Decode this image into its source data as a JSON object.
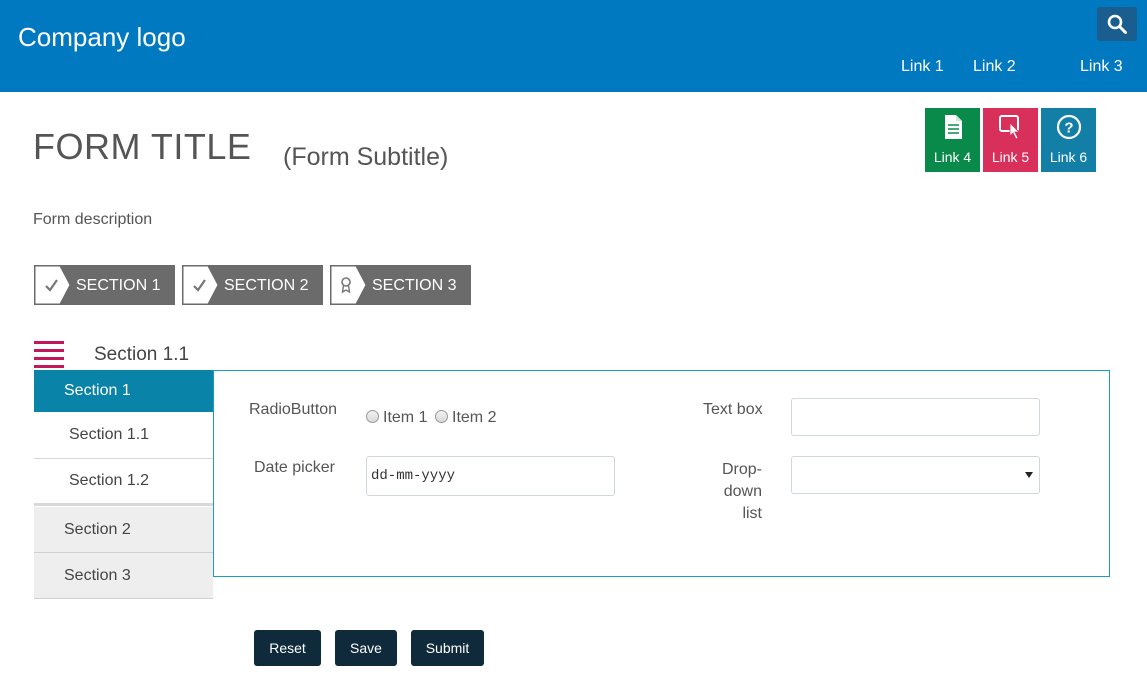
{
  "header": {
    "logo": "Company logo",
    "links": [
      "Link 1",
      "Link 2",
      "Link 3"
    ],
    "color": "#0079c1"
  },
  "form": {
    "title": "FORM TITLE",
    "subtitle": "(Form Subtitle)",
    "description": "Form description"
  },
  "tiles": [
    {
      "label": "Link 4",
      "icon": "document-icon",
      "color": "#0a8a4a"
    },
    {
      "label": "Link 5",
      "icon": "pointer-click-icon",
      "color": "#d9305b"
    },
    {
      "label": "Link 6",
      "icon": "help-circle-icon",
      "color": "#137fa6"
    }
  ],
  "steps": [
    {
      "label": "SECTION 1",
      "icon": "checkmark-icon"
    },
    {
      "label": "SECTION 2",
      "icon": "checkmark-icon"
    },
    {
      "label": "SECTION 3",
      "icon": "award-icon"
    }
  ],
  "section_heading": "Section 1.1",
  "left_nav": [
    {
      "label": "Section 1",
      "active": true
    },
    {
      "label": "Section 1.1"
    },
    {
      "label": "Section 1.2"
    },
    {
      "label": "Section 2"
    },
    {
      "label": "Section 3"
    }
  ],
  "fields": {
    "radio_label": "RadioButton",
    "radio_items": [
      "Item 1",
      "Item 2"
    ],
    "textbox_label": "Text box",
    "textbox_value": "",
    "datepicker_label": "Date picker",
    "datepicker_placeholder": "dd-mm-yyyy",
    "dropdown_label_1": "Drop-down",
    "dropdown_label_2": "list",
    "dropdown_selected": ""
  },
  "buttons": {
    "reset": "Reset",
    "save": "Save",
    "submit": "Submit"
  },
  "colors": {
    "accent": "#0a83a8",
    "step_bg": "#6b6b6b",
    "menu_icon": "#c2185b",
    "button": "#0e2a3b"
  }
}
